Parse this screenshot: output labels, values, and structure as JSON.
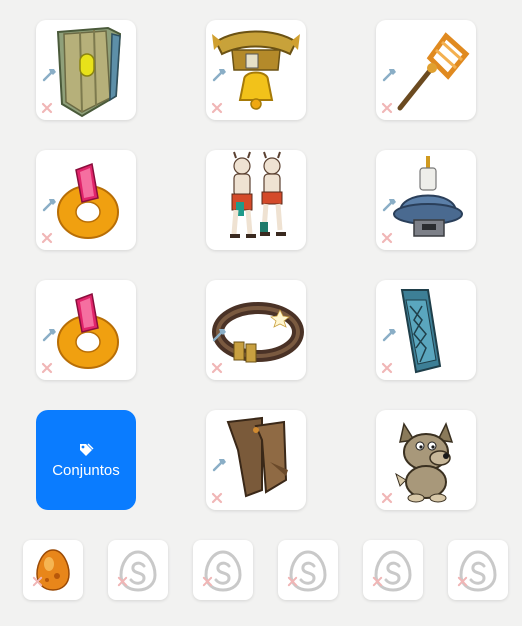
{
  "equipment": {
    "slots": [
      {
        "name": "shield",
        "icon": "shield-icon"
      },
      {
        "name": "amulet",
        "icon": "bell-amulet-icon"
      },
      {
        "name": "weapon",
        "icon": "staff-weapon-icon"
      },
      {
        "name": "ring-left",
        "icon": "ring-icon"
      },
      {
        "name": "character",
        "icon": "character-preview"
      },
      {
        "name": "hat",
        "icon": "hat-icon"
      },
      {
        "name": "ring-right",
        "icon": "ring-icon"
      },
      {
        "name": "belt",
        "icon": "belt-icon"
      },
      {
        "name": "cloak",
        "icon": "cloak-icon"
      },
      {
        "name": "boots",
        "icon": "boots-icon"
      },
      {
        "name": "pet",
        "icon": "pet-icon"
      }
    ],
    "sets_button_label": "Conjuntos",
    "bottom_slots": [
      {
        "name": "dofus-1",
        "icon": "amber-egg-icon",
        "filled": true
      },
      {
        "name": "dofus-2",
        "icon": "dofus-placeholder-icon",
        "filled": false
      },
      {
        "name": "dofus-3",
        "icon": "dofus-placeholder-icon",
        "filled": false
      },
      {
        "name": "dofus-4",
        "icon": "dofus-placeholder-icon",
        "filled": false
      },
      {
        "name": "dofus-5",
        "icon": "dofus-placeholder-icon",
        "filled": false
      },
      {
        "name": "dofus-6",
        "icon": "dofus-placeholder-icon",
        "filled": false
      }
    ]
  },
  "colors": {
    "background": "#f2f2f1",
    "accent": "#0a7cff",
    "hammer": "#8aaec6",
    "remove": "#f0b6b6"
  }
}
